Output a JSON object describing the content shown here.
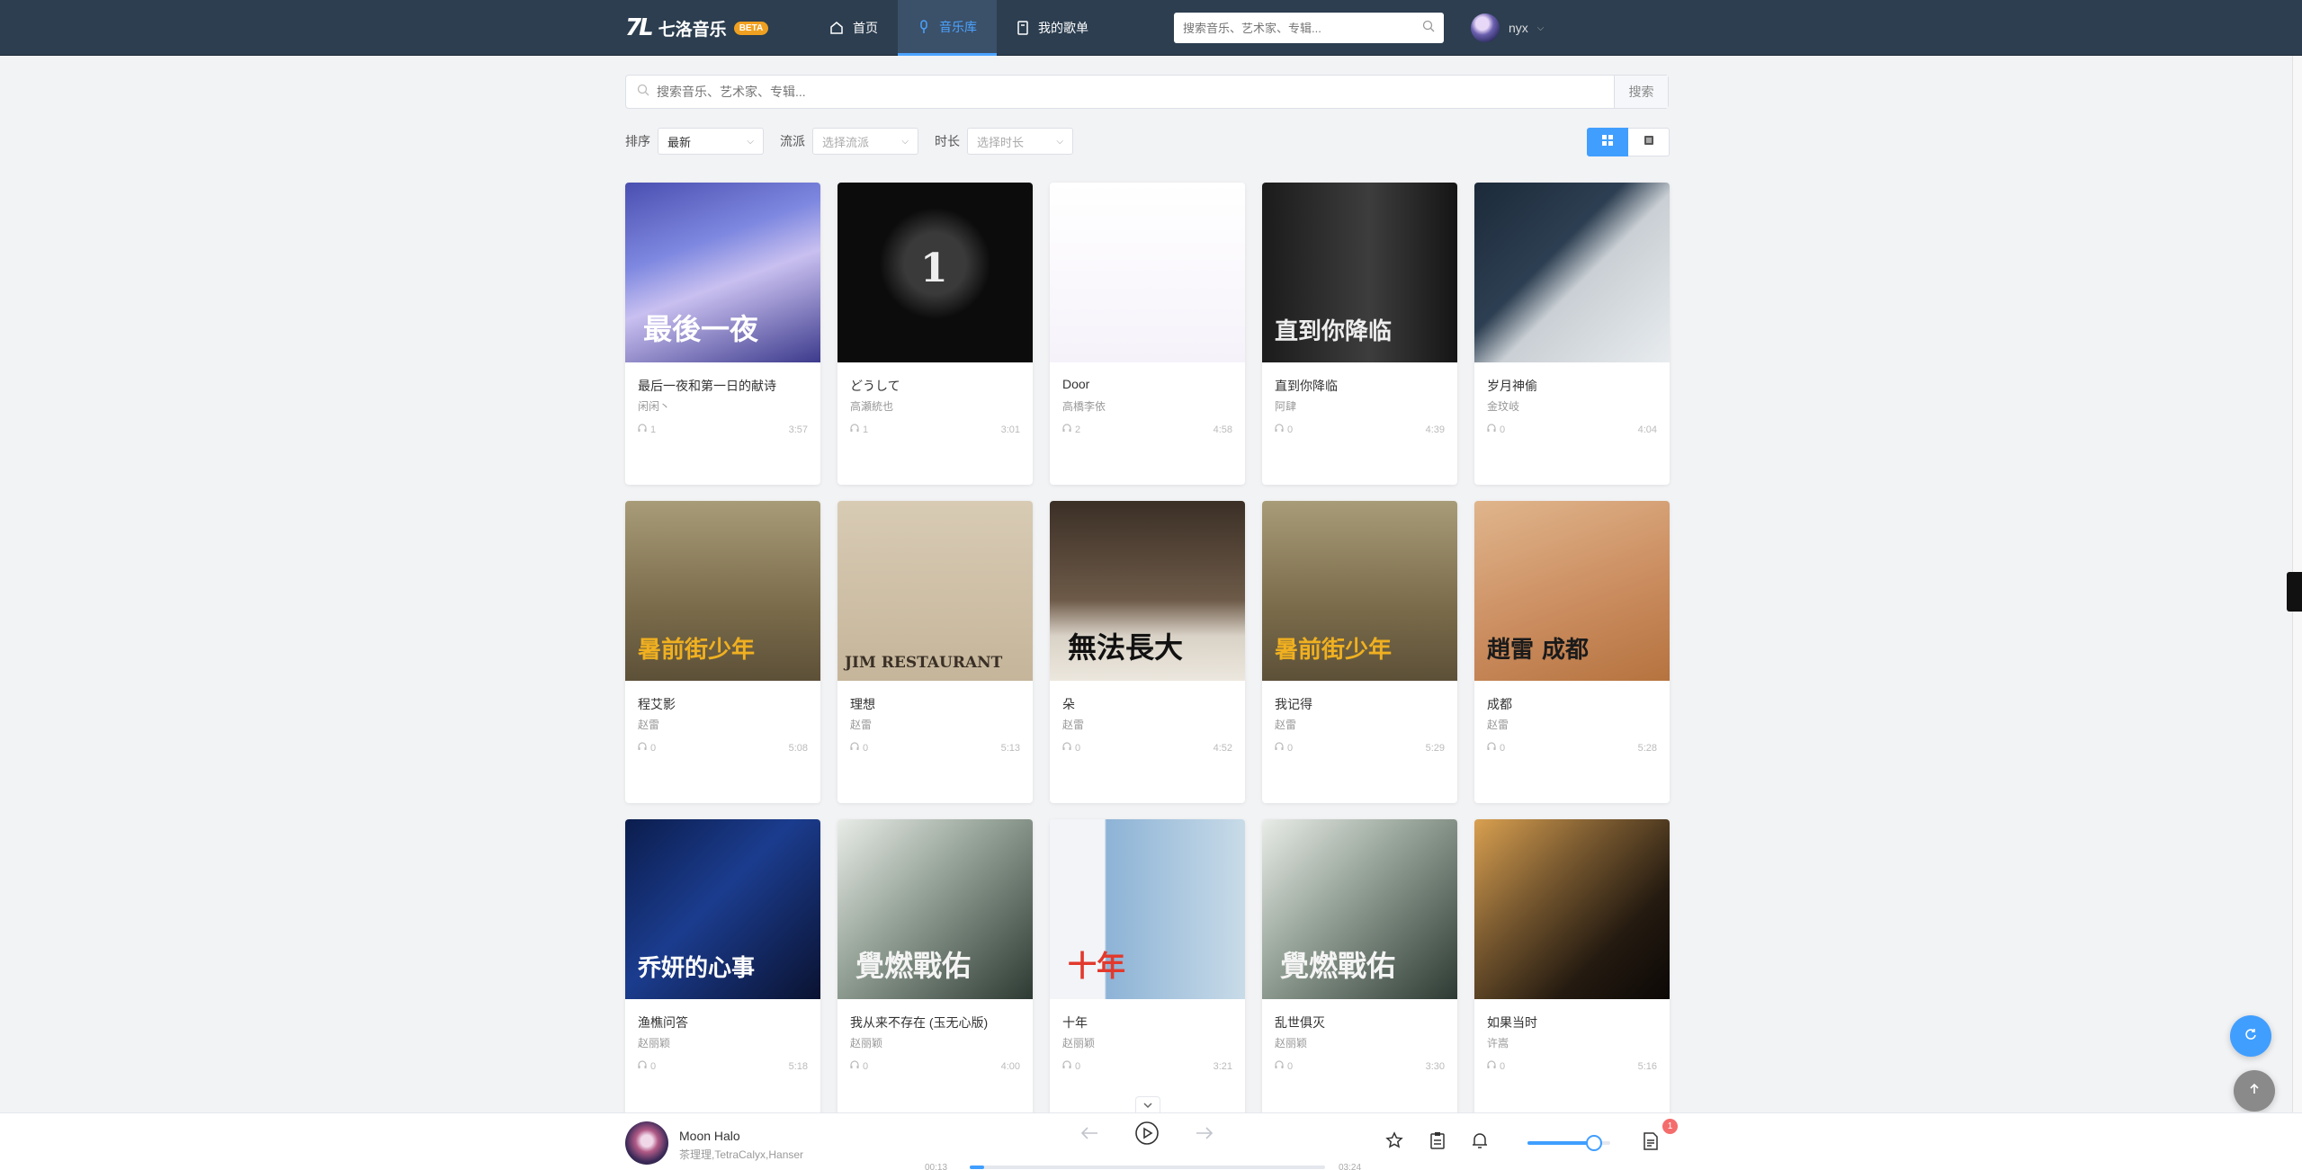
{
  "app": {
    "logo_mark": "7L",
    "name": "七洛音乐",
    "beta": "BETA"
  },
  "nav": [
    {
      "label": "首页",
      "icon": "home-icon"
    },
    {
      "label": "音乐库",
      "icon": "music-library-icon",
      "active": true
    },
    {
      "label": "我的歌单",
      "icon": "playlist-book-icon"
    }
  ],
  "top_search": {
    "placeholder": "搜索音乐、艺术家、专辑..."
  },
  "user": {
    "name": "nyx"
  },
  "main_search": {
    "placeholder": "搜索音乐、艺术家、专辑...",
    "button": "搜索"
  },
  "filters": {
    "sort": {
      "label": "排序",
      "value": "最新"
    },
    "genre": {
      "label": "流派",
      "placeholder": "选择流派"
    },
    "duration": {
      "label": "时长",
      "placeholder": "选择时长"
    }
  },
  "view": {
    "mode": "grid"
  },
  "songs": [
    {
      "title": "最后一夜和第一日的献诗",
      "artist": "闲闲丶",
      "plays": "1",
      "duration": "3:57"
    },
    {
      "title": "どうして",
      "artist": "高瀬統也",
      "plays": "1",
      "duration": "3:01"
    },
    {
      "title": "Door",
      "artist": "高橋李依",
      "plays": "2",
      "duration": "4:58"
    },
    {
      "title": "直到你降临",
      "artist": "阿肆",
      "plays": "0",
      "duration": "4:39"
    },
    {
      "title": "岁月神偷",
      "artist": "金玟岐",
      "plays": "0",
      "duration": "4:04"
    },
    {
      "title": "程艾影",
      "artist": "赵雷",
      "plays": "0",
      "duration": "5:08"
    },
    {
      "title": "理想",
      "artist": "赵雷",
      "plays": "0",
      "duration": "5:13"
    },
    {
      "title": "朵",
      "artist": "赵雷",
      "plays": "0",
      "duration": "4:52"
    },
    {
      "title": "我记得",
      "artist": "赵雷",
      "plays": "0",
      "duration": "5:29"
    },
    {
      "title": "成都",
      "artist": "赵雷",
      "plays": "0",
      "duration": "5:28"
    },
    {
      "title": "渔樵问答",
      "artist": "赵丽颖",
      "plays": "0",
      "duration": "5:18"
    },
    {
      "title": "我从来不存在 (玉无心版)",
      "artist": "赵丽颖",
      "plays": "0",
      "duration": "4:00"
    },
    {
      "title": "十年",
      "artist": "赵丽颖",
      "plays": "0",
      "duration": "3:21"
    },
    {
      "title": "乱世俱灭",
      "artist": "赵丽颖",
      "plays": "0",
      "duration": "3:30"
    },
    {
      "title": "如果当时",
      "artist": "许嵩",
      "plays": "0",
      "duration": "5:16"
    }
  ],
  "covers": [
    {
      "bg": "linear-gradient(160deg,#4a4fb0 0%,#7e88e0 35%,#c9c0f0 55%,#3c3a8c 100%)",
      "text": "最後一夜",
      "color": "#ffffff"
    },
    {
      "bg": "radial-gradient(circle at 50% 45%,#3a3a3a 0 22%,#0c0c0c 40%)",
      "text": "1",
      "color": "#eeeeee"
    },
    {
      "bg": "linear-gradient(180deg,#ffffff 0%,#f6f2fa 100%)",
      "text": "",
      "color": "#333333"
    },
    {
      "bg": "linear-gradient(90deg,#1b1b1b 0%,#3d3d3d 55%,#151515 100%)",
      "text": "直到你降临",
      "color": "#eeeeee"
    },
    {
      "bg": "linear-gradient(135deg,#1c2a3a 0%,#2d3f52 40%,#c9cfd4 55%,#e8ecef 100%)",
      "text": "",
      "color": "#ffffff"
    },
    {
      "bg": "linear-gradient(180deg,#a89c78 0%,#7a6b4a 60%,#5c5038 100%)",
      "text": "暑前街少年",
      "color": "#f0b020"
    },
    {
      "bg": "linear-gradient(180deg,#d8cbb4 0%,#c5b59a 100%)",
      "text": "JIM RESTAURANT",
      "color": "#3a3026"
    },
    {
      "bg": "linear-gradient(180deg,#3b2f26 0%,#6d5a48 55%,#d9d2c6 75%,#ece7de 100%)",
      "text": "無法長大",
      "color": "#111111"
    },
    {
      "bg": "linear-gradient(180deg,#a89c78 0%,#7a6b4a 60%,#5c5038 100%)",
      "text": "暑前街少年",
      "color": "#f0b020"
    },
    {
      "bg": "linear-gradient(160deg,#e0b58c 0%,#c98a5c 60%,#b5733f 100%)",
      "text": "趙雷 成都",
      "color": "#1b1b1b"
    },
    {
      "bg": "linear-gradient(135deg,#0b1d4d 0%,#1b3c8e 45%,#0a1230 100%)",
      "text": "乔妍的心事",
      "color": "#ffffff"
    },
    {
      "bg": "linear-gradient(135deg,#e9ece8 0%,#9aa79c 40%,#2d3a33 100%)",
      "text": "覺燃戰佑",
      "color": "#f4f4f4"
    },
    {
      "bg": "linear-gradient(90deg,#f2f4f8 0%,#f2f4f8 28%,#8db3d6 29%,#c8dbe8 100%)",
      "text": "十年",
      "color": "#e2392c"
    },
    {
      "bg": "linear-gradient(135deg,#e9ece8 0%,#9aa79c 40%,#2d3a33 100%)",
      "text": "覺燃戰佑",
      "color": "#f4f4f4"
    },
    {
      "bg": "linear-gradient(135deg,#d9a050 0%,#7a5a30 35%,#241a10 70%,#0c0806 100%)",
      "text": "",
      "color": "#ffffff"
    }
  ],
  "player": {
    "title": "Moon Halo",
    "artist": "茶理理,TetraCalyx,Hanser",
    "time_current": "00:13",
    "time_total": "03:24",
    "progress": 0.04,
    "volume": 0.8,
    "queue_count": "1"
  },
  "colors": {
    "accent": "#409eff",
    "topbar": "#2c3e50",
    "beta": "#f0a020",
    "badge": "#f56c6c"
  }
}
